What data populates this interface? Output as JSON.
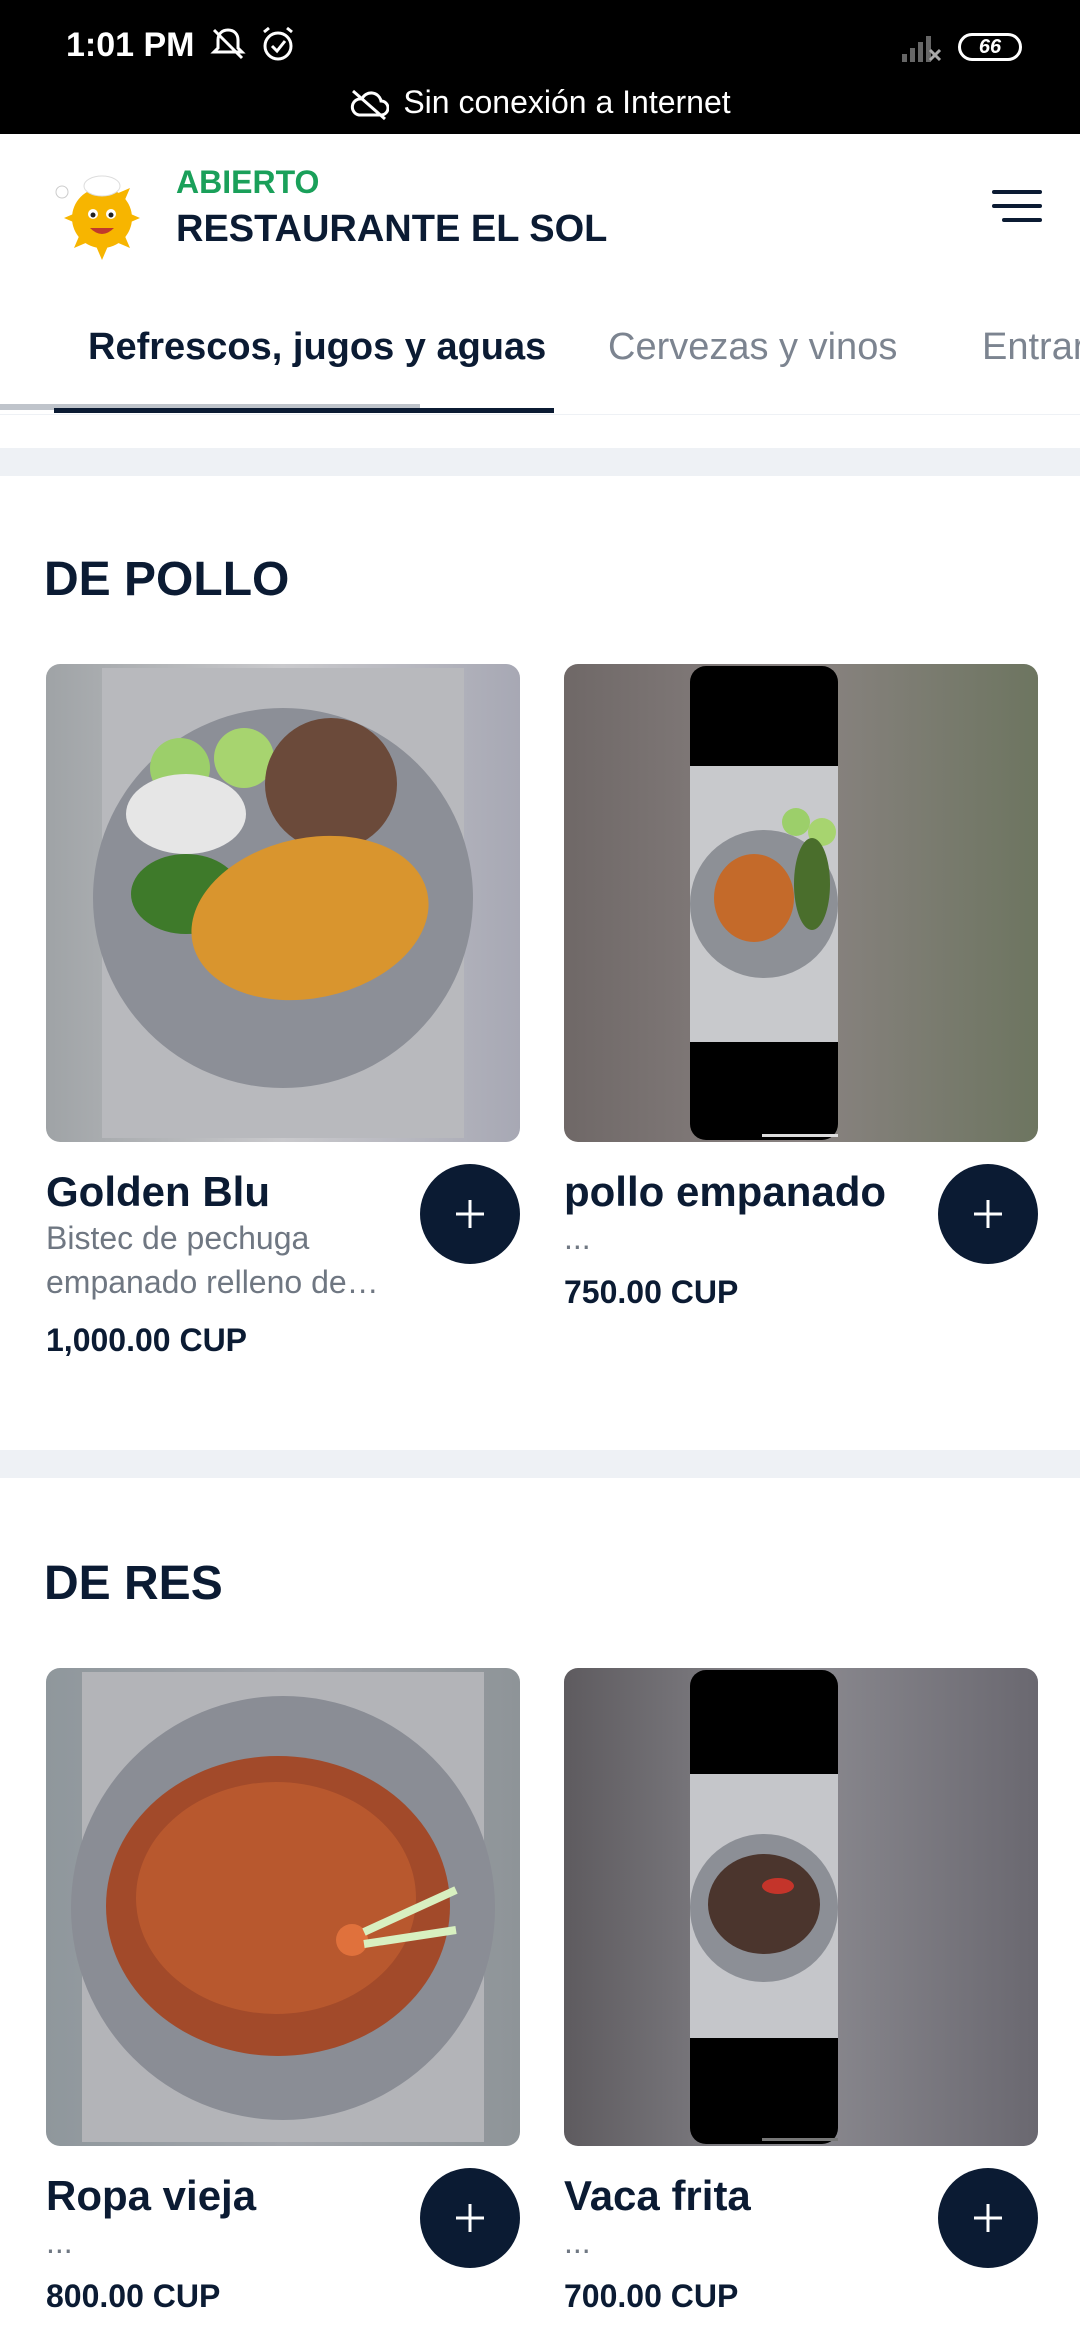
{
  "status_bar": {
    "time": "1:01 PM",
    "battery": "66",
    "offline_text": "Sin conexión a Internet"
  },
  "header": {
    "status": "ABIERTO",
    "restaurant_name": "RESTAURANTE EL SOL",
    "menu_icon": "hamburger-menu-icon"
  },
  "tabs": [
    {
      "label": "Refrescos, jugos y aguas",
      "active": true
    },
    {
      "label": "Cervezas y vinos",
      "active": false
    },
    {
      "label": "Entrar",
      "active": false
    }
  ],
  "sections": [
    {
      "title": "DE POLLO",
      "items": [
        {
          "name": "Golden Blu",
          "desc": "Bistec de pechuga empanado relleno de…",
          "price": "1,000.00 CUP"
        },
        {
          "name": "pollo empanado",
          "desc": "...",
          "price": "750.00 CUP"
        }
      ]
    },
    {
      "title": "DE RES",
      "items": [
        {
          "name": "Ropa vieja",
          "desc": "...",
          "price": "800.00 CUP"
        },
        {
          "name": "Vaca frita",
          "desc": "...",
          "price": "700.00 CUP"
        }
      ]
    }
  ],
  "colors": {
    "primary": "#0b1b33",
    "open_green": "#1aa05a",
    "muted": "#7c8490"
  }
}
